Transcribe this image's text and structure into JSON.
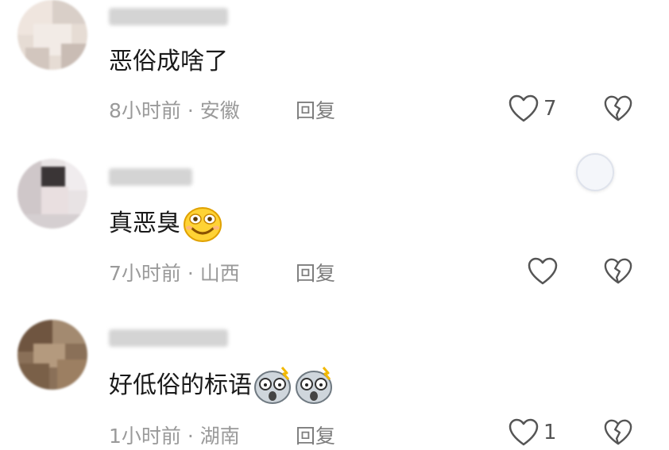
{
  "comments": [
    {
      "text": "恶俗成啥了",
      "meta": "8小时前 · 安徽",
      "reply_label": "回复",
      "like_count": "7",
      "emoji": []
    },
    {
      "text": "真恶臭",
      "meta": "7小时前 · 山西",
      "reply_label": "回复",
      "like_count": "",
      "emoji": [
        "smiling-face-icon"
      ]
    },
    {
      "text": "好低俗的标语",
      "meta": "1小时前 · 湖南",
      "reply_label": "回复",
      "like_count": "1",
      "emoji": [
        "shocked-face-icon",
        "shocked-face-icon"
      ]
    }
  ],
  "colors": {
    "text": "#1a1a1a",
    "meta": "#9a9a9a",
    "reply": "#7d7d7d",
    "icon": "#555555"
  }
}
